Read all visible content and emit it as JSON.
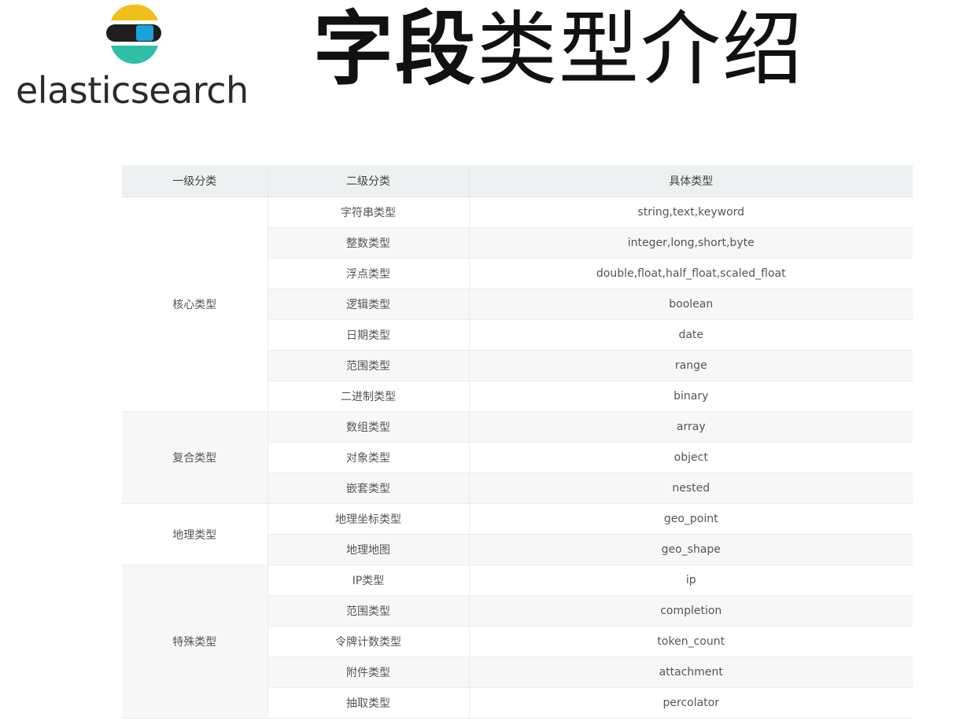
{
  "logo": {
    "text": "elasticsearch"
  },
  "title": {
    "bold_part": "字段",
    "rest": "类型介绍"
  },
  "table": {
    "headers": [
      "一级分类",
      "二级分类",
      "具体类型"
    ],
    "groups": [
      {
        "category": "核心类型",
        "rows": [
          {
            "sub": "字符串类型",
            "spec": "string,text,keyword"
          },
          {
            "sub": "整数类型",
            "spec": "integer,long,short,byte"
          },
          {
            "sub": "浮点类型",
            "spec": "double,float,half_float,scaled_float"
          },
          {
            "sub": "逻辑类型",
            "spec": "boolean"
          },
          {
            "sub": "日期类型",
            "spec": "date"
          },
          {
            "sub": "范围类型",
            "spec": "range"
          },
          {
            "sub": "二进制类型",
            "spec": "binary"
          }
        ]
      },
      {
        "category": "复合类型",
        "rows": [
          {
            "sub": "数组类型",
            "spec": "array"
          },
          {
            "sub": "对象类型",
            "spec": "object"
          },
          {
            "sub": "嵌套类型",
            "spec": "nested"
          }
        ]
      },
      {
        "category": "地理类型",
        "rows": [
          {
            "sub": "地理坐标类型",
            "spec": "geo_point"
          },
          {
            "sub": "地理地图",
            "spec": "geo_shape"
          }
        ]
      },
      {
        "category": "特殊类型",
        "rows": [
          {
            "sub": "IP类型",
            "spec": "ip"
          },
          {
            "sub": "范围类型",
            "spec": "completion"
          },
          {
            "sub": "令牌计数类型",
            "spec": "token_count"
          },
          {
            "sub": "附件类型",
            "spec": "attachment"
          },
          {
            "sub": "抽取类型",
            "spec": "percolator"
          }
        ]
      }
    ]
  }
}
